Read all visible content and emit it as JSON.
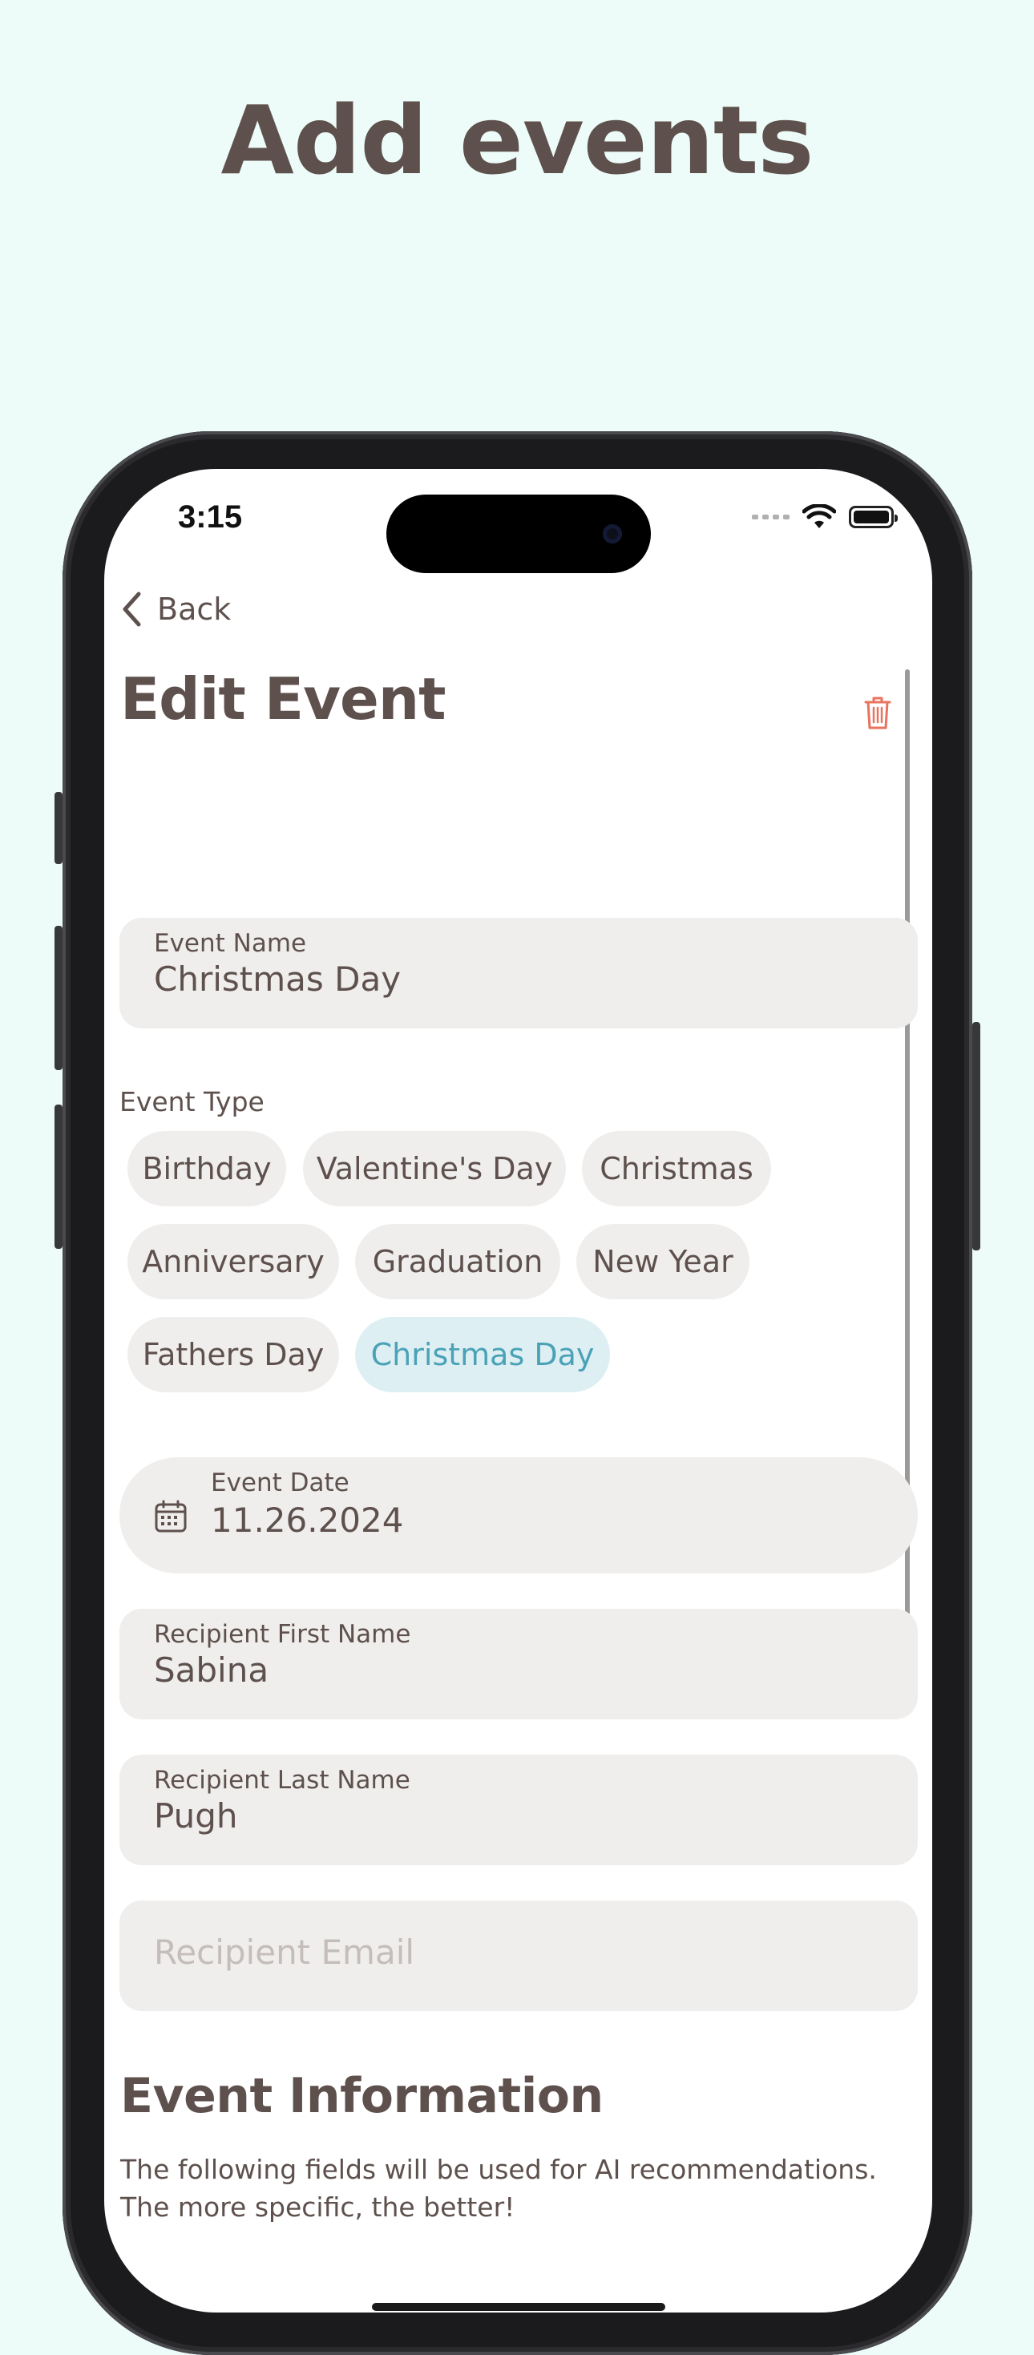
{
  "headline": "Add events",
  "status_bar": {
    "time": "3:15"
  },
  "nav": {
    "back_label": "Back"
  },
  "page_title": "Edit Event",
  "event_name": {
    "label": "Event Name",
    "value": "Christmas Day"
  },
  "event_type": {
    "label": "Event Type",
    "chips": [
      "Birthday",
      "Valentine's Day",
      "Christmas",
      "Anniversary",
      "Graduation",
      "New Year",
      "Fathers Day",
      "Christmas Day"
    ],
    "selected": "Christmas Day"
  },
  "event_date": {
    "label": "Event Date",
    "value": "11.26.2024"
  },
  "recipient_first": {
    "label": "Recipient First Name",
    "value": "Sabina"
  },
  "recipient_last": {
    "label": "Recipient Last Name",
    "value": "Pugh"
  },
  "recipient_email": {
    "placeholder": "Recipient Email"
  },
  "event_info": {
    "title": "Event Information",
    "description": "The following fields will be used for AI recommendations. The more specific, the better!"
  },
  "colors": {
    "background": "#EDFCF9",
    "text": "#5E514D",
    "field": "#F0EEED",
    "chip_selected_bg": "#DDEFF3",
    "chip_selected_text": "#4AA2B7",
    "delete": "#E8735E"
  }
}
